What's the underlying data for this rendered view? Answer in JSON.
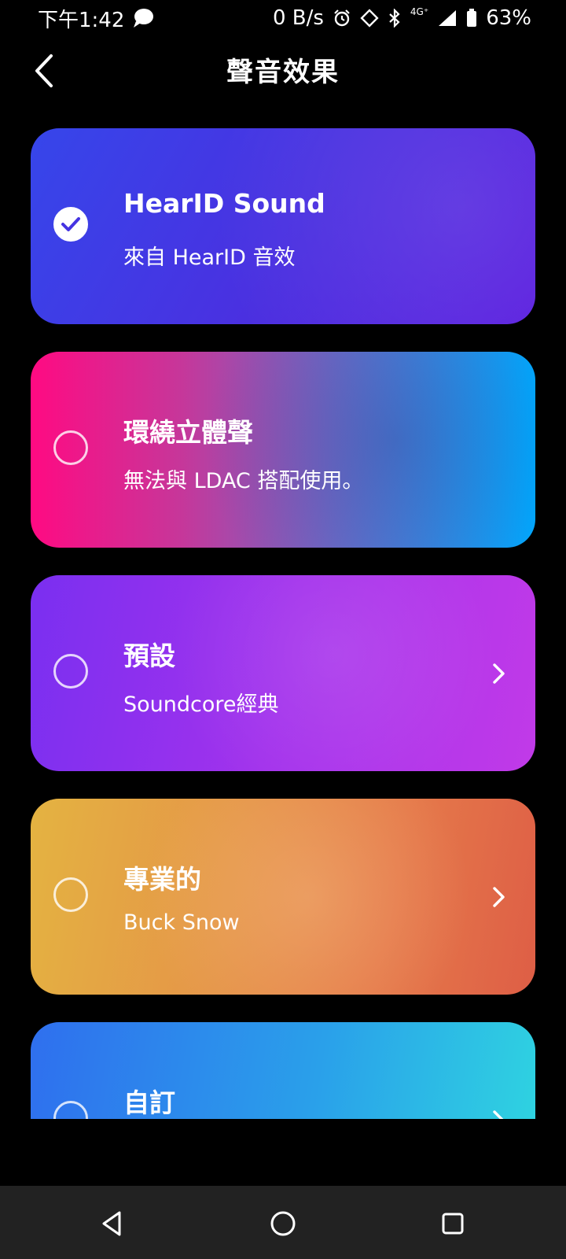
{
  "status_bar": {
    "time": "下午1:42",
    "net_speed": "0 B/s",
    "network": "4G⁺",
    "battery": "63%"
  },
  "header": {
    "title": "聲音效果"
  },
  "cards": [
    {
      "title": "HearID Sound",
      "subtitle": "來自 HearID 音效",
      "selected": true
    },
    {
      "title": "環繞立體聲",
      "subtitle": "無法與 LDAC 搭配使用。",
      "selected": false
    },
    {
      "title": "預設",
      "subtitle": "Soundcore經典",
      "selected": false
    },
    {
      "title": "專業的",
      "subtitle": "Buck Snow",
      "selected": false
    },
    {
      "title": "自訂",
      "subtitle": "",
      "selected": false
    }
  ],
  "icons": {
    "back": "chevron-left-icon",
    "selected": "check-icon",
    "more": "chevron-right-icon",
    "nav_back": "triangle-back-icon",
    "nav_home": "circle-home-icon",
    "nav_recent": "square-recent-icon"
  }
}
